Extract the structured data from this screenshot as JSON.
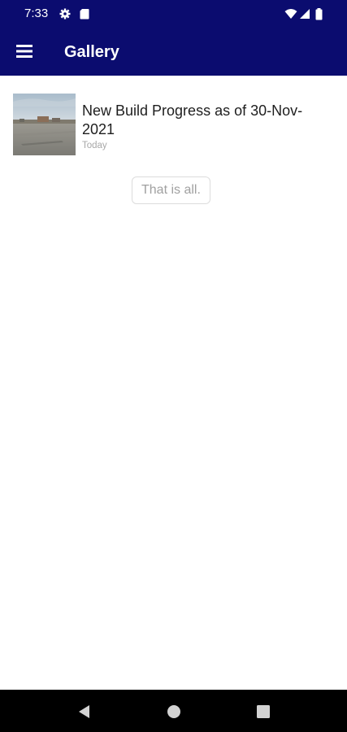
{
  "status_bar": {
    "time": "7:33",
    "icons": [
      "settings-gear-icon",
      "sd-card-icon",
      "wifi-icon",
      "cell-signal-icon",
      "battery-icon"
    ]
  },
  "app_bar": {
    "title": "Gallery",
    "menu_icon": "hamburger-menu-icon",
    "background_color": "#0b0c6f"
  },
  "gallery": {
    "items": [
      {
        "title": "New Build Progress as of 30-Nov-2021",
        "date": "Today",
        "thumbnail": "construction-site-photo"
      }
    ],
    "end_message": "That is all."
  },
  "nav_bar": {
    "buttons": [
      "back-icon",
      "home-icon",
      "recents-icon"
    ]
  }
}
